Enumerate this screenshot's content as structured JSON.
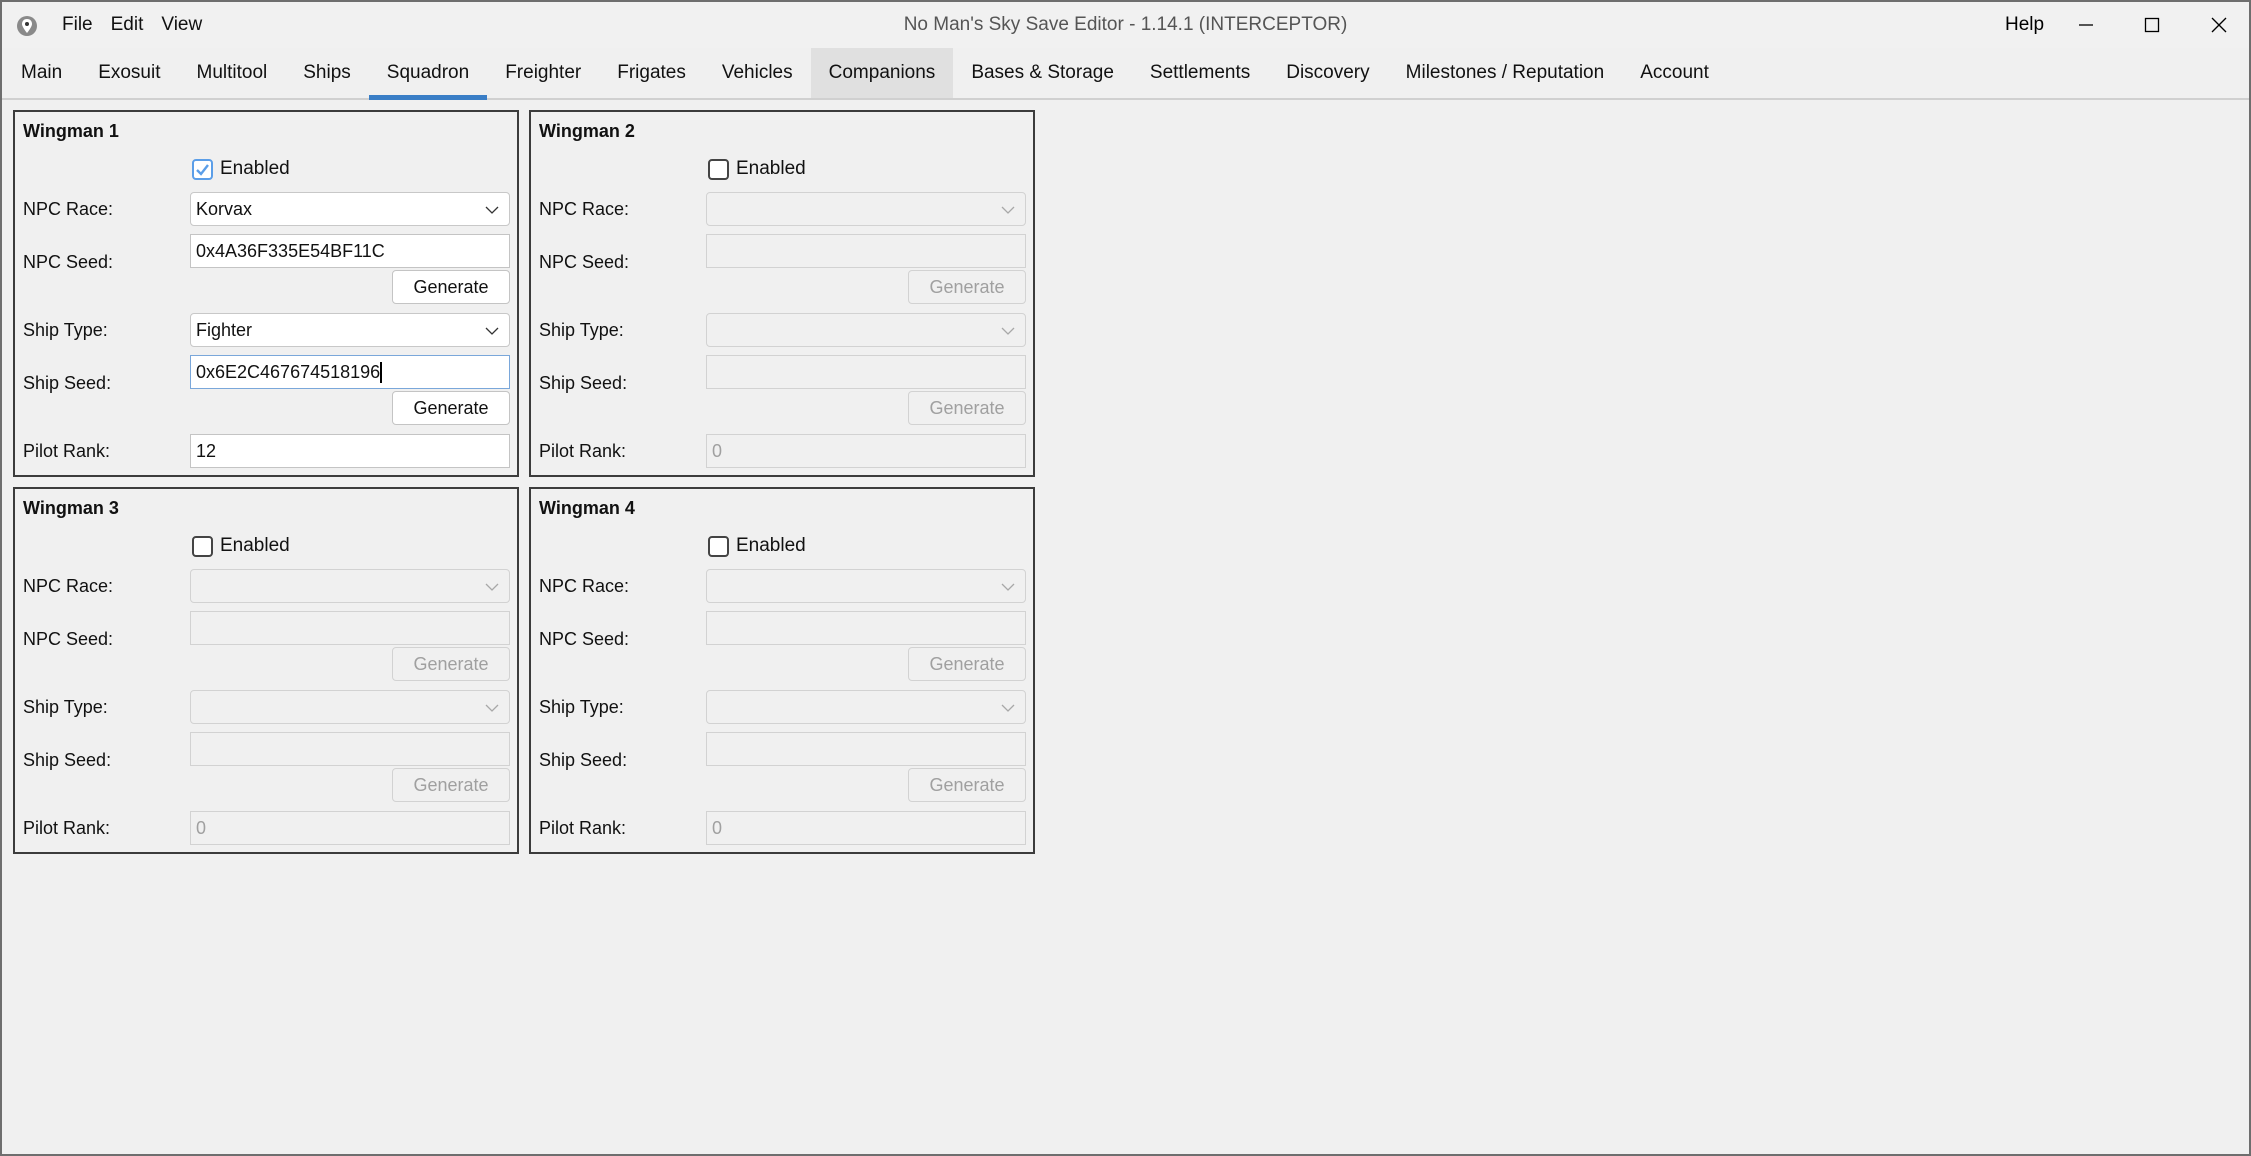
{
  "window": {
    "title": "No Man's Sky Save Editor - 1.14.1 (INTERCEPTOR)",
    "menus": [
      "File",
      "Edit",
      "View"
    ],
    "help_label": "Help",
    "controls": [
      "minimize-icon",
      "maximize-icon",
      "close-icon"
    ]
  },
  "tabs": [
    {
      "label": "Main"
    },
    {
      "label": "Exosuit"
    },
    {
      "label": "Multitool"
    },
    {
      "label": "Ships"
    },
    {
      "label": "Squadron",
      "active": true
    },
    {
      "label": "Freighter"
    },
    {
      "label": "Frigates"
    },
    {
      "label": "Vehicles"
    },
    {
      "label": "Companions",
      "hover": true
    },
    {
      "label": "Bases & Storage"
    },
    {
      "label": "Settlements"
    },
    {
      "label": "Discovery"
    },
    {
      "label": "Milestones / Reputation"
    },
    {
      "label": "Account"
    }
  ],
  "labels": {
    "enabled": "Enabled",
    "npc_race": "NPC Race:",
    "npc_seed": "NPC Seed:",
    "ship_type": "Ship Type:",
    "ship_seed": "Ship Seed:",
    "pilot_rank": "Pilot Rank:",
    "generate": "Generate"
  },
  "colors": {
    "accent": "#3a7ec6",
    "checkbox_checked": "#5b9ee8",
    "disabled_text": "#a0a0a0"
  },
  "wingmen": [
    {
      "title": "Wingman 1",
      "enabled": true,
      "npc_race": "Korvax",
      "npc_seed": "0x4A36F335E54BF11C",
      "ship_type": "Fighter",
      "ship_seed": "0x6E2C467674518196",
      "pilot_rank": "12"
    },
    {
      "title": "Wingman 2",
      "enabled": false,
      "npc_race": "",
      "npc_seed": "",
      "ship_type": "",
      "ship_seed": "",
      "pilot_rank": "0"
    },
    {
      "title": "Wingman 3",
      "enabled": false,
      "npc_race": "",
      "npc_seed": "",
      "ship_type": "",
      "ship_seed": "",
      "pilot_rank": "0"
    },
    {
      "title": "Wingman 4",
      "enabled": false,
      "npc_race": "",
      "npc_seed": "",
      "ship_type": "",
      "ship_seed": "",
      "pilot_rank": "0"
    }
  ]
}
